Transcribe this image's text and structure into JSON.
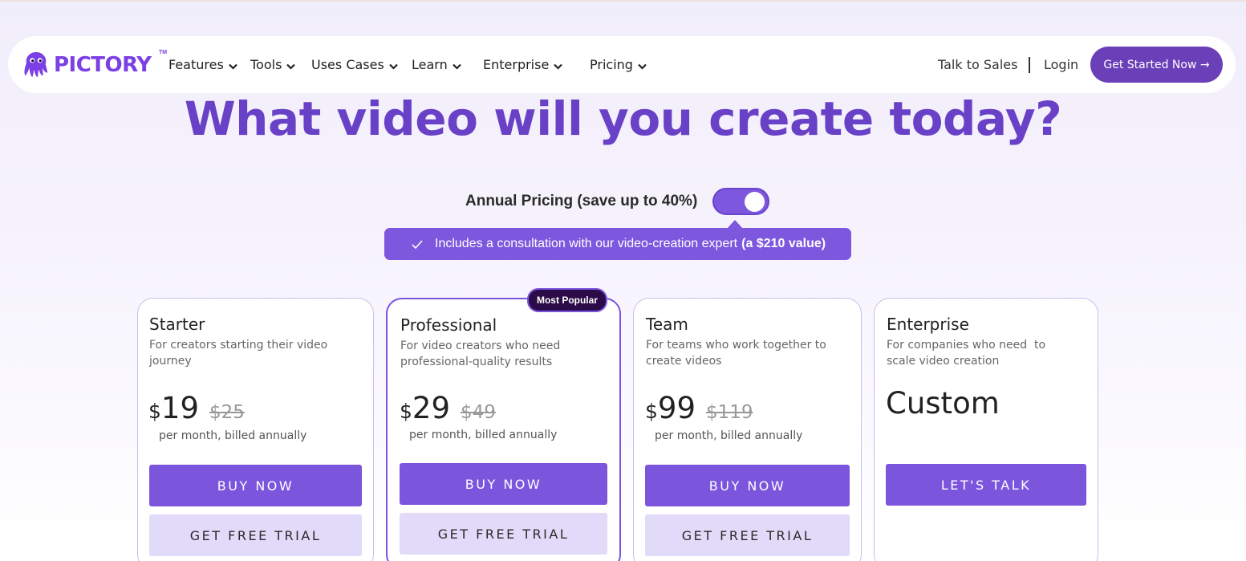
{
  "brand": {
    "name": "PICTORY",
    "tm": "TM",
    "accent": "#7b3fe4"
  },
  "nav": {
    "items": [
      {
        "label": "Features",
        "icon": "chevron-down-icon"
      },
      {
        "label": "Tools",
        "icon": "chevron-down-icon"
      },
      {
        "label": "Uses Cases",
        "icon": "chevron-down-icon"
      },
      {
        "label": "Learn",
        "icon": "chevron-down-icon"
      },
      {
        "label": "Enterprise",
        "icon": "chevron-down-icon"
      },
      {
        "label": "Pricing",
        "icon": "chevron-down-icon"
      }
    ],
    "talk_to_sales": "Talk to Sales",
    "login": "Login",
    "cta": "Get Started Now →"
  },
  "hero": {
    "title": "What video will you create today?"
  },
  "pricing_toggle": {
    "label": "Annual Pricing (save up to 40%)",
    "on": true,
    "callout_text": "Includes a consultation with our video-creation expert",
    "callout_bold": "(a $210 value)"
  },
  "plans": [
    {
      "name": "Starter",
      "description": "For creators starting their video journey",
      "currency": "$",
      "price": "19",
      "old_price": "$25",
      "period": "per month, billed annually",
      "buy_label": "BUY NOW",
      "trial_label": "GET FREE TRIAL"
    },
    {
      "name": "Professional",
      "badge": "Most Popular",
      "description": "For video creators who need professional-quality results",
      "currency": "$",
      "price": "29",
      "old_price": "$49",
      "period": "per month, billed annually",
      "buy_label": "BUY NOW",
      "trial_label": "GET FREE TRIAL"
    },
    {
      "name": "Team",
      "description": "For teams who work together to create videos",
      "currency": "$",
      "price": "99",
      "old_price": "$119",
      "period": "per month, billed annually",
      "buy_label": "BUY NOW",
      "trial_label": "GET FREE TRIAL"
    },
    {
      "name": "Enterprise",
      "description": "For companies who need  to scale video creation",
      "price_text": "Custom",
      "cta_label": "LET'S TALK"
    }
  ],
  "colors": {
    "primary": "#7c55dd",
    "primary_dark": "#6a3fb8",
    "heading": "#6941c6",
    "trial_bg": "#e2daf9",
    "badge_bg": "#2c0c48"
  }
}
